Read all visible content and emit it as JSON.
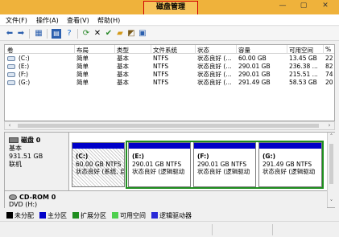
{
  "window": {
    "title": "磁盘管理",
    "minimize_glyph": "—",
    "maximize_glyph": "▢",
    "close_glyph": "✕"
  },
  "menu": {
    "items": [
      {
        "label": "文件(F)"
      },
      {
        "label": "操作(A)"
      },
      {
        "label": "查看(V)"
      },
      {
        "label": "帮助(H)"
      }
    ]
  },
  "toolbar": {
    "icons": [
      "back-arrow-icon",
      "forward-arrow-icon",
      "disk-list-icon",
      "properties-icon",
      "help-book-icon",
      "refresh-icon",
      "delete-x-icon",
      "check-icon",
      "open-folder-icon",
      "explore-icon",
      "disk-manage-icon"
    ]
  },
  "volume_table": {
    "columns": [
      "卷",
      "布局",
      "类型",
      "文件系统",
      "状态",
      "容量",
      "可用空间",
      "%"
    ],
    "rows": [
      {
        "volume": "(C:)",
        "layout": "简单",
        "type": "基本",
        "fs": "NTFS",
        "status": "状态良好 (...",
        "capacity": "60.00 GB",
        "free": "13.45 GB",
        "pct": "22"
      },
      {
        "volume": "(E:)",
        "layout": "简单",
        "type": "基本",
        "fs": "NTFS",
        "status": "状态良好 (...",
        "capacity": "290.01 GB",
        "free": "236.38 ...",
        "pct": "82"
      },
      {
        "volume": "(F:)",
        "layout": "简单",
        "type": "基本",
        "fs": "NTFS",
        "status": "状态良好 (...",
        "capacity": "290.01 GB",
        "free": "215.51 ...",
        "pct": "74"
      },
      {
        "volume": "(G:)",
        "layout": "简单",
        "type": "基本",
        "fs": "NTFS",
        "status": "状态良好 (...",
        "capacity": "291.49 GB",
        "free": "58.53 GB",
        "pct": "20"
      }
    ]
  },
  "disk0": {
    "name": "磁盘 0",
    "type": "基本",
    "size": "931.51 GB",
    "state": "联机",
    "partitions": [
      {
        "title": "(C:)",
        "size": "60.00 GB NTFS",
        "status": "状态良好 (系统, 启"
      },
      {
        "title": "(E:)",
        "size": "290.01 GB NTFS",
        "status": "状态良好 (逻辑驱动"
      },
      {
        "title": "(F:)",
        "size": "290.01 GB NTFS",
        "status": "状态良好 (逻辑驱动"
      },
      {
        "title": "(G:)",
        "size": "291.49 GB NTFS",
        "status": "状态良好 (逻辑驱动"
      }
    ]
  },
  "cdrom0": {
    "name": "CD-ROM 0",
    "detail": "DVD (H:)"
  },
  "legend": [
    {
      "label": "未分配",
      "color": "#000000"
    },
    {
      "label": "主分区",
      "color": "#0000c8"
    },
    {
      "label": "扩展分区",
      "color": "#1f8e1f"
    },
    {
      "label": "可用空间",
      "color": "#4fd04f"
    },
    {
      "label": "逻辑驱动器",
      "color": "#2a2ad8"
    }
  ]
}
